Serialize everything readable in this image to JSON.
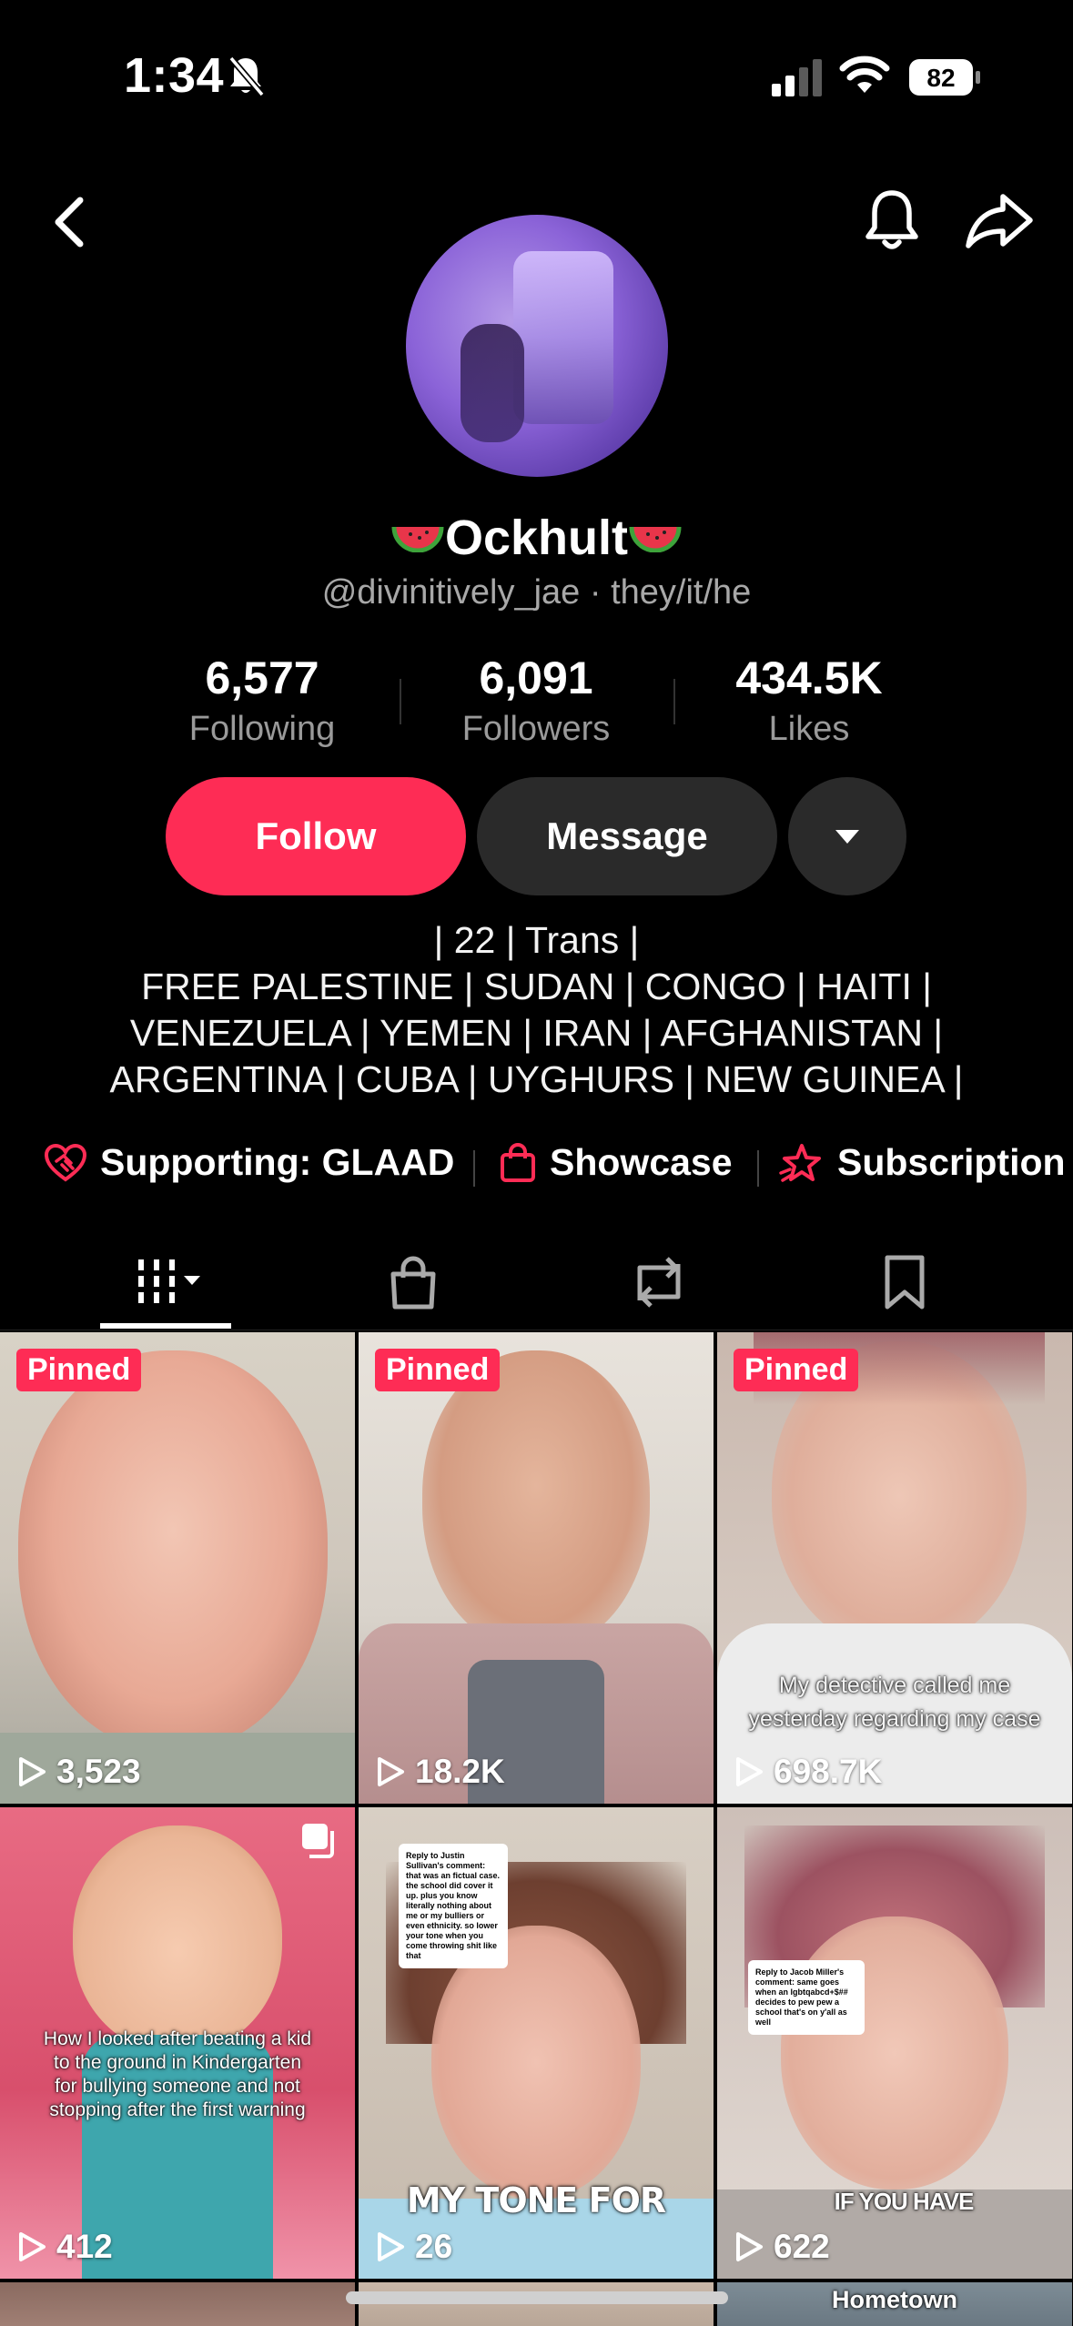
{
  "status_bar": {
    "time": "1:34",
    "battery": "82"
  },
  "profile": {
    "display_name": "Ockhult",
    "handle": "@divinitively_jae",
    "pronouns": "they/it/he",
    "separator": " · "
  },
  "stats": [
    {
      "value": "6,577",
      "label": "Following"
    },
    {
      "value": "6,091",
      "label": "Followers"
    },
    {
      "value": "434.5K",
      "label": "Likes"
    }
  ],
  "buttons": {
    "follow": "Follow",
    "message": "Message"
  },
  "bio": [
    "| 22 | Trans |",
    "FREE PALESTINE | SUDAN | CONGO | HAITI |",
    "VENEZUELA | YEMEN | IRAN | AFGHANISTAN |",
    "ARGENTINA | CUBA | UYGHURS | NEW GUINEA |"
  ],
  "links": {
    "supporting": "Supporting: GLAAD",
    "showcase": "Showcase",
    "subscription": "Subscription"
  },
  "colors": {
    "accent": "#fe2c55",
    "secondary_button": "#2a2a2a",
    "muted_text": "#a8a8a8"
  },
  "videos": [
    {
      "pinned_label": "Pinned",
      "views": "3,523",
      "caption": ""
    },
    {
      "pinned_label": "Pinned",
      "views": "18.2K",
      "caption": ""
    },
    {
      "pinned_label": "Pinned",
      "views": "698.7K",
      "caption": "My detective called me yesterday regarding my case"
    },
    {
      "views": "412",
      "caption": "How I looked after beating a kid to the ground in Kindergarten for bullying someone and not stopping after the first warning"
    },
    {
      "views": "26",
      "caption": "MY TONE FOR",
      "note": "Reply to Justin Sullivan's comment: that was an fictual case. the school did cover it up. plus you know literally nothing about me or my bulliers or even ethnicity. so lower your tone when you come throwing shit like that"
    },
    {
      "views": "622",
      "caption": "IF YOU HAVE",
      "note": "Reply to Jacob Miller's comment: same goes when an lgbtqabcd+$## decides to pew pew a school that's on y'all as well"
    },
    {
      "caption": "Hometown"
    }
  ]
}
